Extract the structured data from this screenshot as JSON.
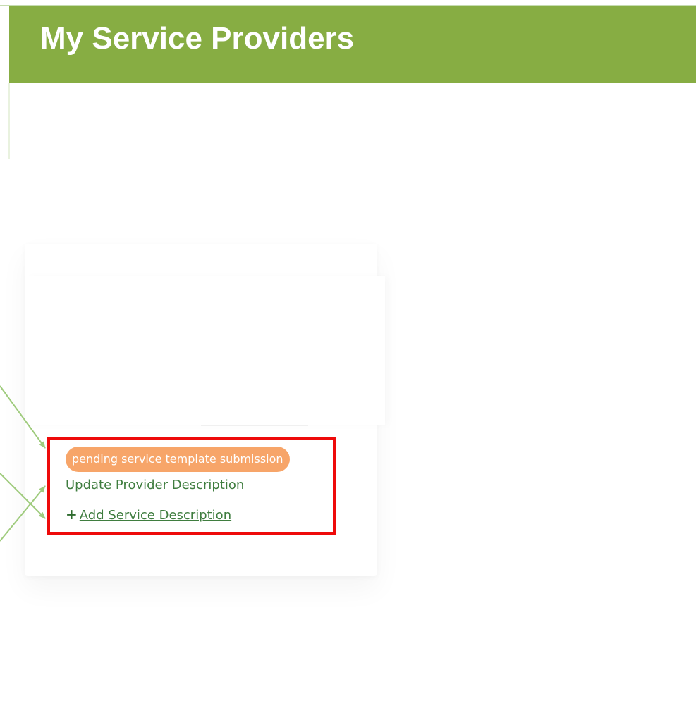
{
  "header": {
    "title": "My Service Providers",
    "background_color": "#87ad43",
    "text_color": "#ffffff"
  },
  "provider_card": {
    "status_badge": {
      "label": "pending service template submission",
      "color": "#f7a569"
    },
    "update_link_label": "Update Provider Description",
    "add_link_label": "Add Service Description",
    "add_icon": "plus-icon",
    "link_color": "#3f7d3f"
  },
  "annotation": {
    "highlight_color": "#ee0a0a",
    "arrow_color": "#9fcb7d"
  }
}
